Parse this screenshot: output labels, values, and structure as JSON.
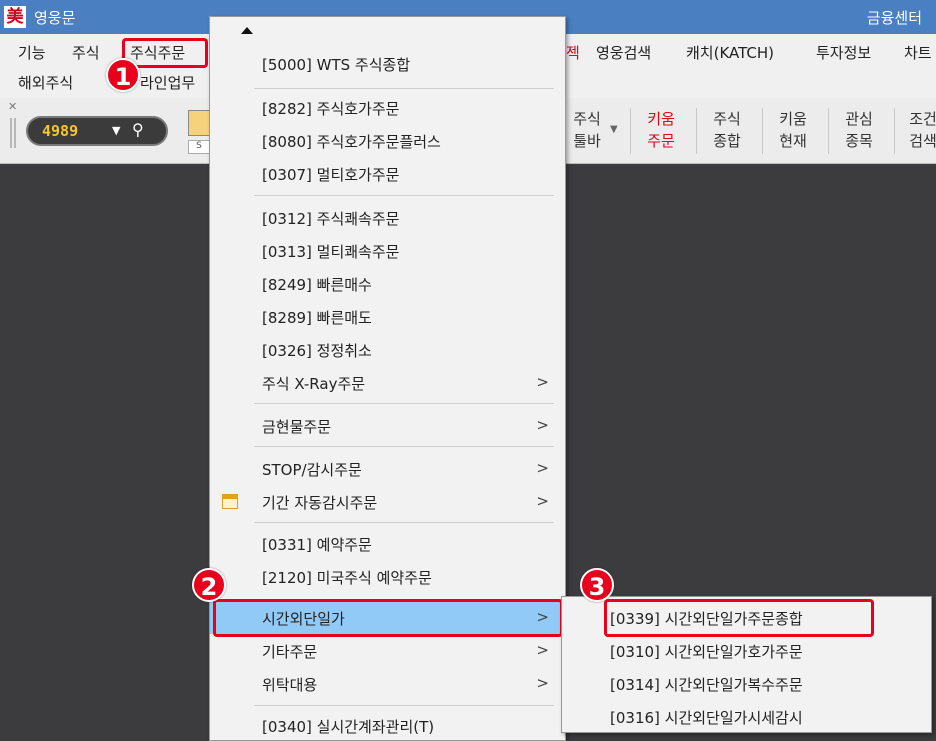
{
  "titlebar": {
    "logo_char": "美",
    "app_title": "영웅문",
    "right_text": "금융센터"
  },
  "menubar": {
    "row1": [
      "기능",
      "주식",
      "주식주문",
      "젝",
      "영웅검색",
      "캐치(KATCH)",
      "투자정보",
      "차트"
    ],
    "row2": [
      "해외주식",
      "라인업무"
    ]
  },
  "toolbar": {
    "stock_code": "4989",
    "buttons": [
      {
        "l1": "주식",
        "l2": "툴바"
      },
      {
        "l1": "키움",
        "l2": "주문"
      },
      {
        "l1": "주식",
        "l2": "종합"
      },
      {
        "l1": "키움",
        "l2": "현재"
      },
      {
        "l1": "관심",
        "l2": "종목"
      },
      {
        "l1": "조건",
        "l2": "검색"
      }
    ],
    "small_label": "S"
  },
  "dropdown": {
    "items": [
      "[5000] WTS 주식종합",
      "[8282] 주식호가주문",
      "[8080] 주식호가주문플러스",
      "[0307] 멀티호가주문",
      "[0312] 주식쾌속주문",
      "[0313] 멀티쾌속주문",
      "[8249] 빠른매수",
      "[8289] 빠른매도",
      "[0326] 정정취소",
      "주식 X-Ray주문",
      "금현물주문",
      "STOP/감시주문",
      "기간 자동감시주문",
      "[0331] 예약주문",
      "[2120] 미국주식 예약주문",
      "시간외단일가",
      "기타주문",
      "위탁대용",
      "[0340] 실시간계좌관리(T)"
    ],
    "submenu_arrow": ">"
  },
  "submenu": {
    "items": [
      "[0339] 시간외단일가주문종합",
      "[0310] 시간외단일가호가주문",
      "[0314] 시간외단일가복수주문",
      "[0316] 시간외단일가시세감시"
    ]
  },
  "annotations": {
    "step1": "1",
    "step2": "2",
    "step3": "3"
  },
  "colors": {
    "accent_red": "#e8001c",
    "highlight_blue": "#91c9f7",
    "titlebar_blue": "#4a7fc1"
  }
}
